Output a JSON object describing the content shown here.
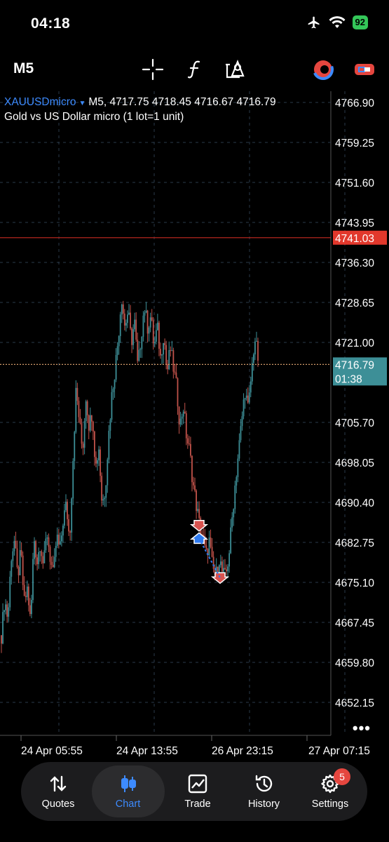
{
  "status": {
    "time": "04:18",
    "battery": "92"
  },
  "toolbar": {
    "timeframe": "M5",
    "icons": [
      "crosshair-icon",
      "indicators-icon",
      "objects-icon",
      "signals-icon",
      "one-click-trading-icon"
    ]
  },
  "chart": {
    "symbol": "XAUUSDmicro",
    "ohlc_text": "M5, 4717.75 4718.45 4716.67 4716.79",
    "description": "Gold vs US Dollar micro (1 lot=1 unit)",
    "current_price": "4716.79",
    "countdown": "01:38",
    "alert_price": "4741.03",
    "colors": {
      "bull": "#3d8f97",
      "bear": "#c0524a",
      "grid": "#2a3a4a",
      "alert_line": "#b3261e",
      "price_line": "#d29a6a",
      "current_box": "#3d8f97",
      "alert_box": "#e2382c",
      "arrow_sell": "#d9534f",
      "arrow_buy": "#2f7bf0"
    }
  },
  "chart_data": {
    "type": "candlestick",
    "symbol": "XAUUSDmicro",
    "timeframe": "M5",
    "y_ticks": [
      "4766.90",
      "4759.25",
      "4751.60",
      "4743.95",
      "4736.30",
      "4728.65",
      "4721.00",
      "4705.70",
      "4698.05",
      "4690.40",
      "4682.75",
      "4675.10",
      "4667.45",
      "4659.80",
      "4652.15"
    ],
    "x_ticks": [
      "24 Apr 05:55",
      "24 Apr 13:55",
      "26 Apr 23:15",
      "27 Apr 07:15"
    ],
    "ylim": [
      4650,
      4769
    ],
    "price_path": [
      4665,
      4672,
      4668,
      4680,
      4683,
      4676,
      4681,
      4671,
      4674,
      4667,
      4684,
      4679,
      4683,
      4678,
      4685,
      4680,
      4676,
      4684,
      4681,
      4687,
      4690,
      4683,
      4698,
      4712,
      4706,
      4700,
      4711,
      4705,
      4708,
      4697,
      4701,
      4690,
      4693,
      4703,
      4711,
      4716,
      4722,
      4730,
      4724,
      4727,
      4721,
      4725,
      4716,
      4722,
      4728,
      4724,
      4726,
      4720,
      4724,
      4718,
      4723,
      4715,
      4720,
      4716,
      4712,
      4705,
      4709,
      4703,
      4700,
      4694,
      4690,
      4686,
      4684,
      4680,
      4683,
      4678,
      4676,
      4680,
      4677,
      4676,
      4680,
      4687,
      4694,
      4700,
      4706,
      4712,
      4708,
      4715,
      4722,
      4718
    ],
    "trades": [
      {
        "type": "sell",
        "price": 4686.0
      },
      {
        "type": "buy",
        "price": 4683.5
      },
      {
        "type": "sell",
        "price": 4676.0
      }
    ],
    "alert_level": 4741.03,
    "current_level": 4716.79
  },
  "more_label": "•••",
  "nav": {
    "items": [
      {
        "label": "Quotes"
      },
      {
        "label": "Chart"
      },
      {
        "label": "Trade"
      },
      {
        "label": "History"
      },
      {
        "label": "Settings"
      }
    ],
    "settings_badge": "5"
  }
}
